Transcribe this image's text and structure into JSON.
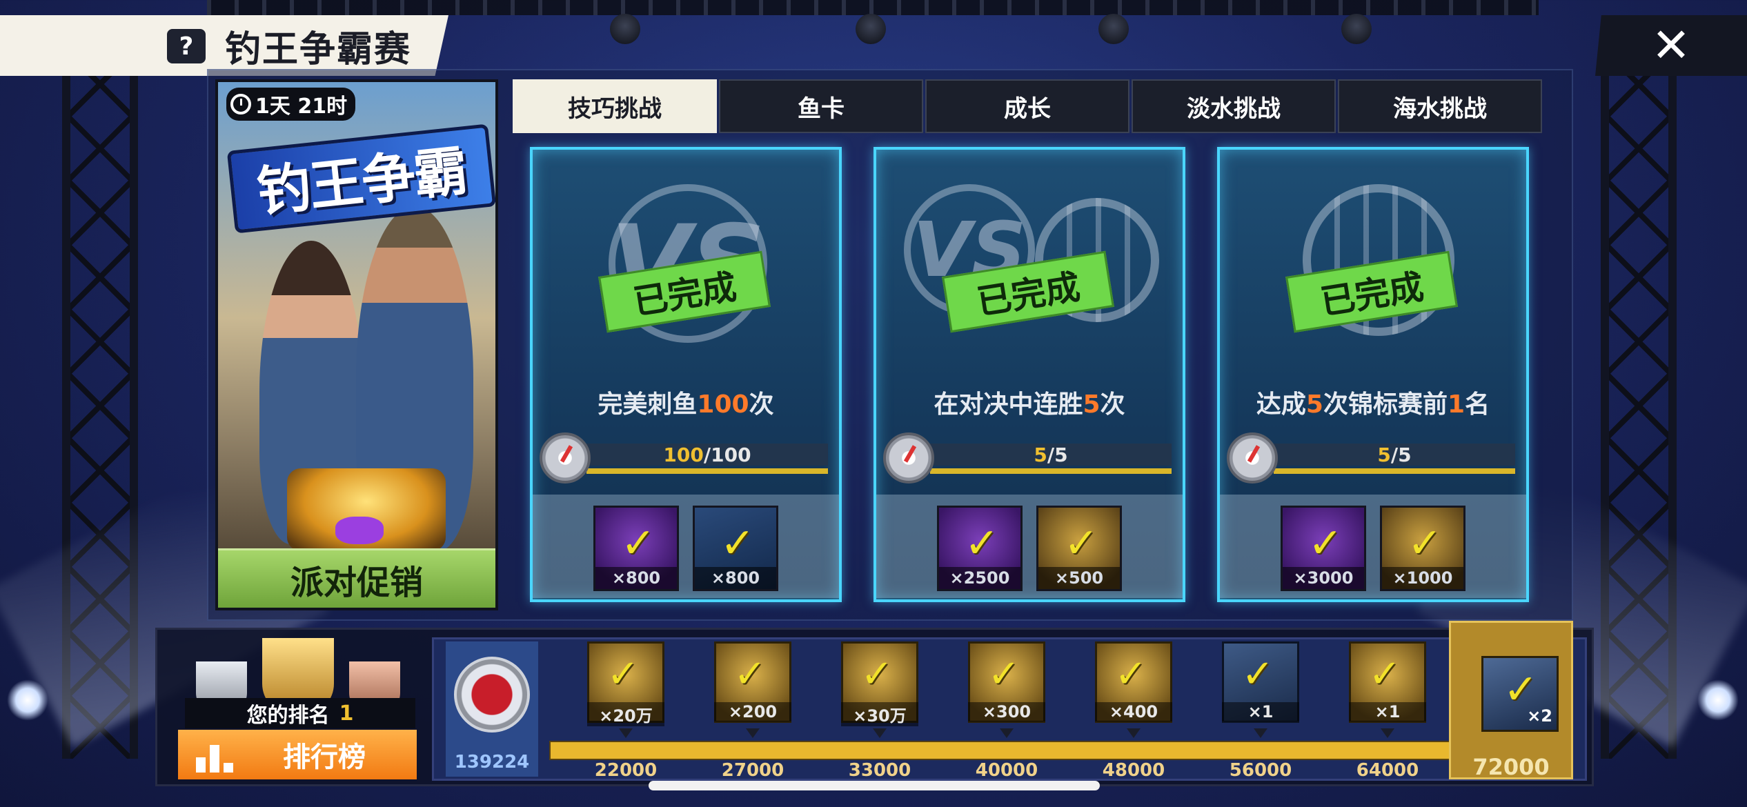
{
  "header": {
    "help_icon": "question-icon",
    "title": "钓王争霸赛",
    "close_icon": "close-icon"
  },
  "promo": {
    "timer": "1天 21时",
    "logo_text": "钓王争霸",
    "button_label": "派对促销"
  },
  "tabs": [
    {
      "label": "技巧挑战",
      "active": true
    },
    {
      "label": "鱼卡",
      "active": false
    },
    {
      "label": "成长",
      "active": false
    },
    {
      "label": "淡水挑战",
      "active": false
    },
    {
      "label": "海水挑战",
      "active": false
    }
  ],
  "cards": [
    {
      "stamp": "已完成",
      "task_pre": "完美刺鱼",
      "task_num": "100",
      "task_post": "次",
      "progress_current": "100",
      "progress_total": "/100",
      "rewards": [
        {
          "qty": "×800"
        },
        {
          "qty": "×800"
        }
      ]
    },
    {
      "stamp": "已完成",
      "task_pre": "在对决中连胜",
      "task_num": "5",
      "task_post": "次",
      "progress_current": "5",
      "progress_total": "/5",
      "rewards": [
        {
          "qty": "×2500"
        },
        {
          "qty": "×500"
        }
      ]
    },
    {
      "stamp": "已完成",
      "task_pre": "达成",
      "task_num": "5",
      "task_mid": "次锦标赛前",
      "task_num2": "1",
      "task_post": "名",
      "progress_current": "5",
      "progress_total": "/5",
      "rewards": [
        {
          "qty": "×3000"
        },
        {
          "qty": "×1000"
        }
      ]
    }
  ],
  "ranking": {
    "label": "您的排名",
    "value": "1",
    "button_label": "排行榜"
  },
  "track": {
    "score": "139224",
    "milestones": [
      {
        "qty": "×20万",
        "value": "22000"
      },
      {
        "qty": "×200",
        "value": "27000"
      },
      {
        "qty": "×30万",
        "value": "33000"
      },
      {
        "qty": "×300",
        "value": "40000"
      },
      {
        "qty": "×400",
        "value": "48000"
      },
      {
        "qty": "×1",
        "value": "56000"
      },
      {
        "qty": "×1",
        "value": "64000"
      }
    ],
    "final": {
      "qty": "×2",
      "value": "72000"
    }
  },
  "colors": {
    "accent_green": "#6fd84a",
    "highlight_orange": "#ff7a2a",
    "card_glow": "#4ad6ff",
    "leaderboard_orange": "#f27a12"
  }
}
